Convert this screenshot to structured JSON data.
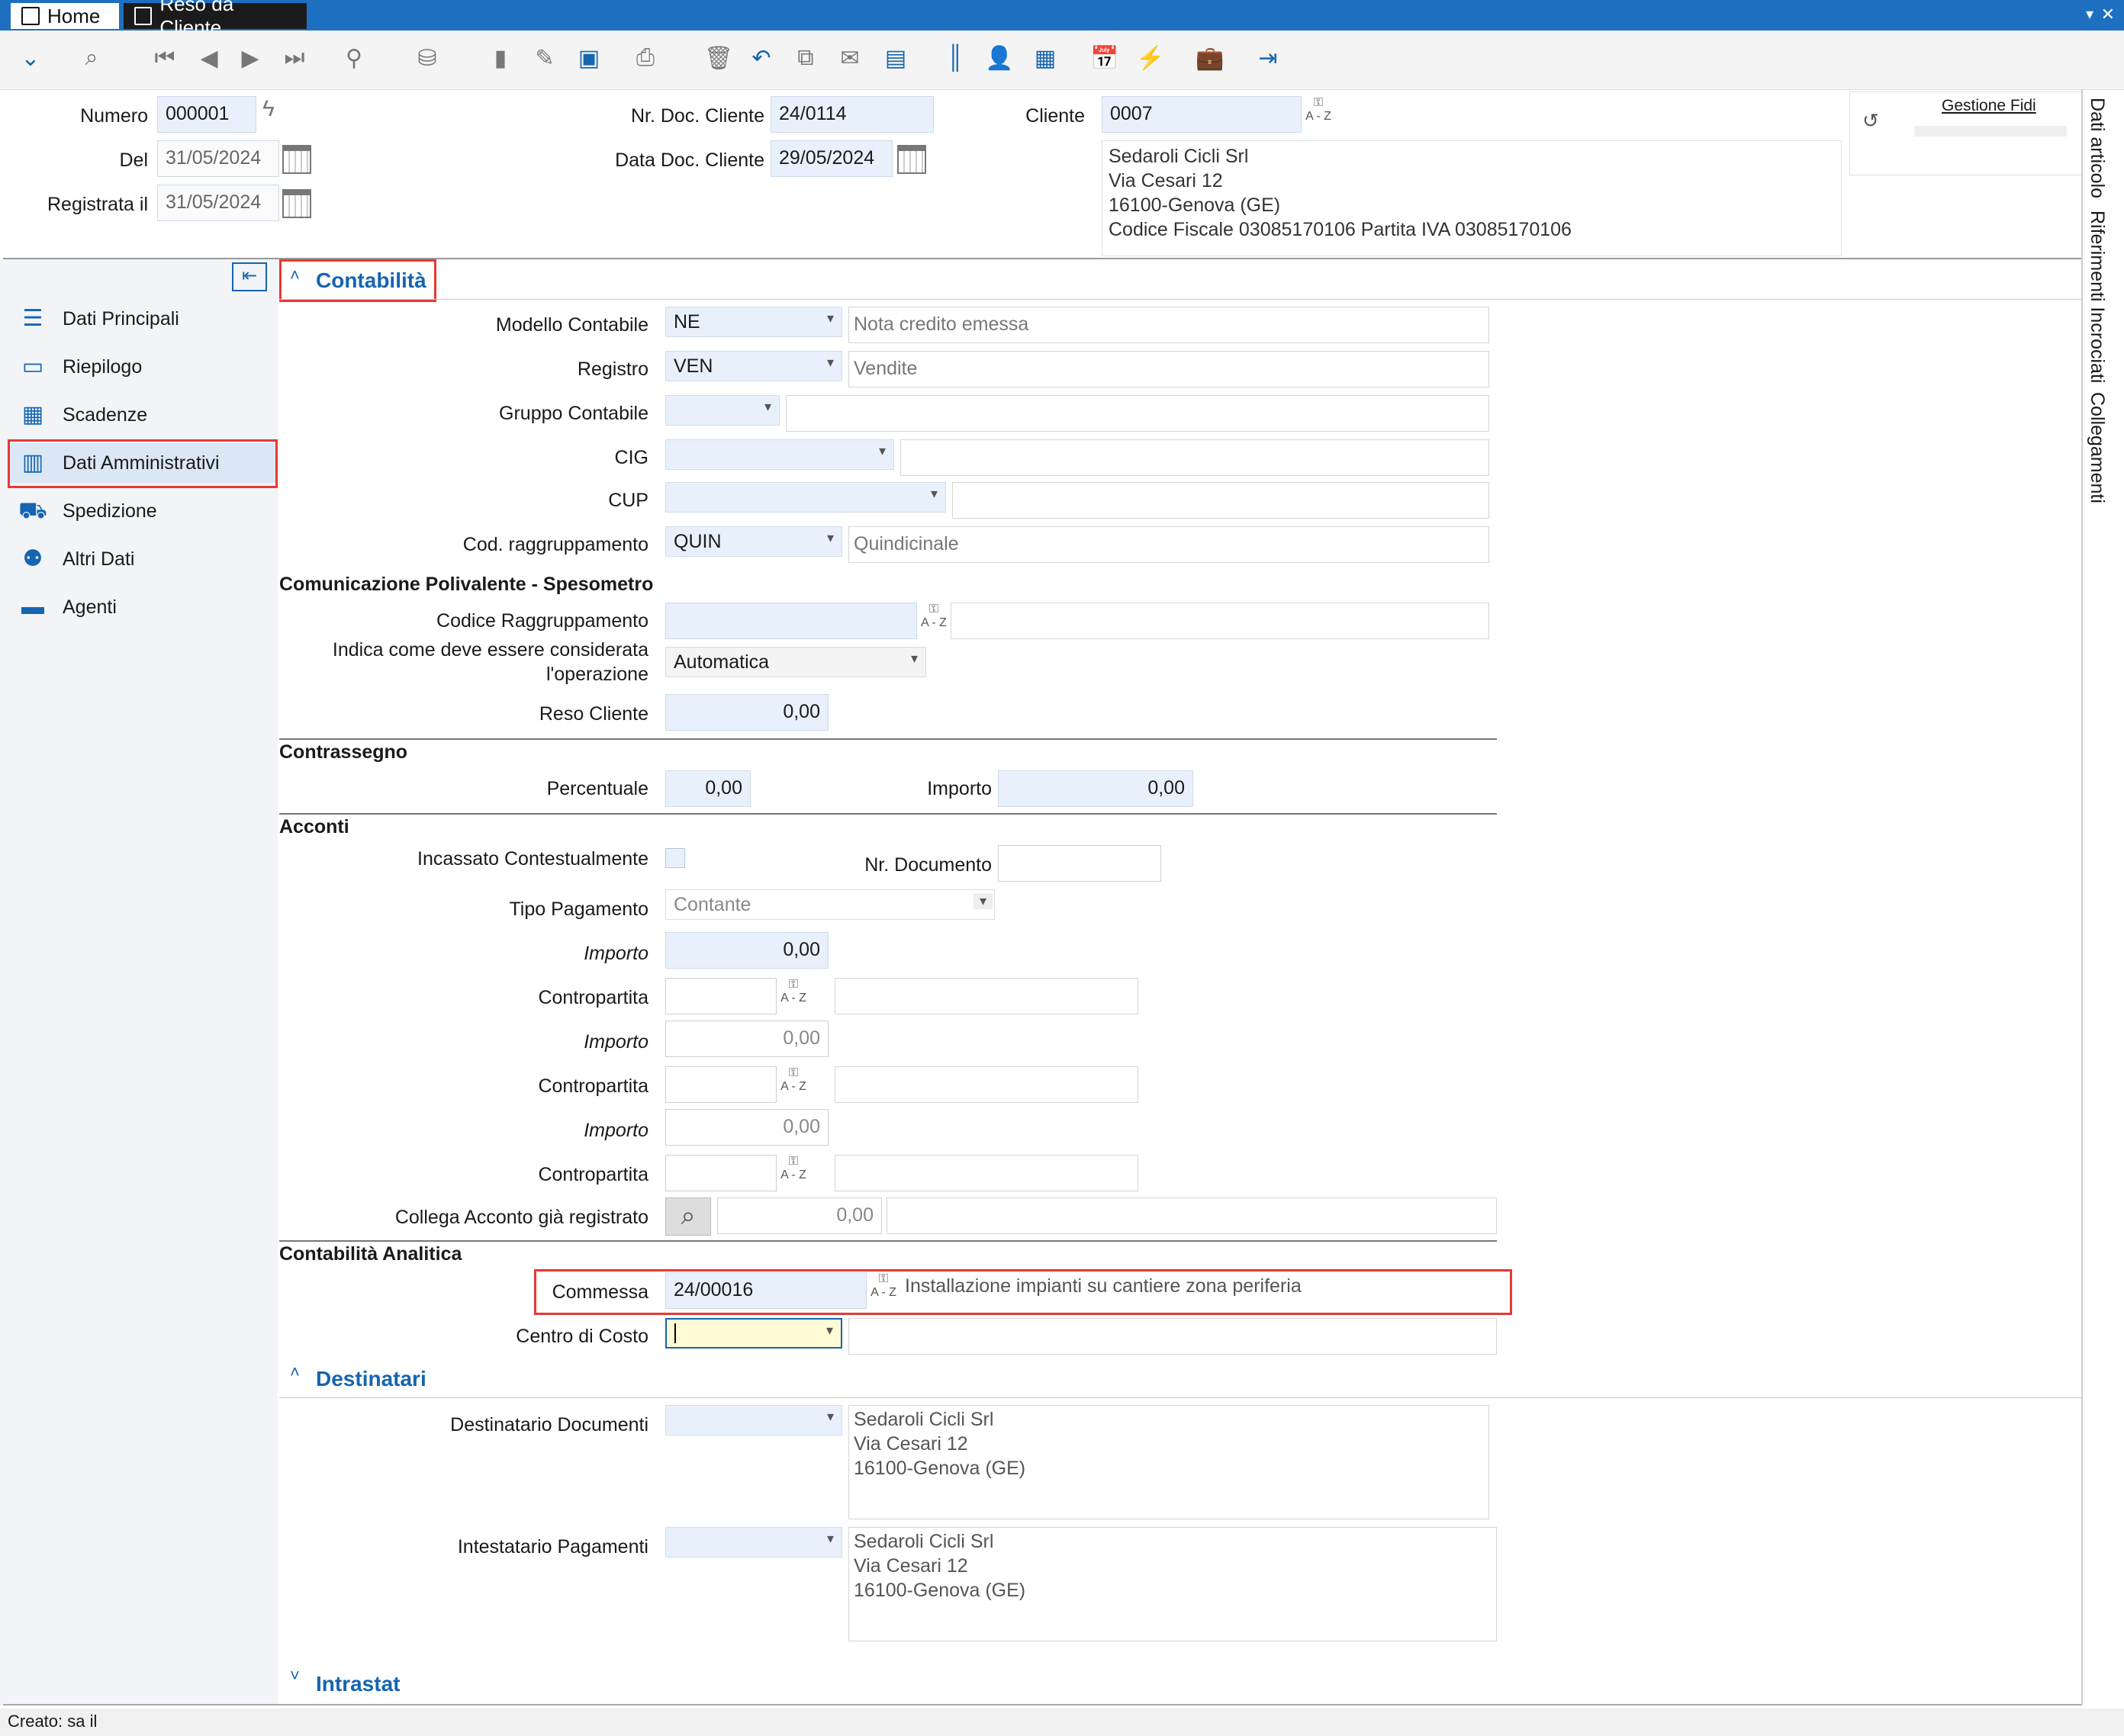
{
  "tabs": {
    "home": "Home",
    "reso": "Reso da Cliente"
  },
  "header": {
    "numero_label": "Numero",
    "numero": "000001",
    "del_label": "Del",
    "del": "31/05/2024",
    "registrata_label": "Registrata il",
    "registrata": "31/05/2024",
    "nrdoc_label": "Nr. Doc. Cliente",
    "nrdoc": "24/0114",
    "datadoc_label": "Data Doc. Cliente",
    "datadoc": "29/05/2024",
    "cliente_label": "Cliente",
    "cliente": "0007",
    "cliente_addr": [
      "Sedaroli Cicli Srl",
      "Via Cesari 12",
      "16100-Genova (GE)",
      "Codice Fiscale 03085170106 Partita IVA 03085170106"
    ],
    "gestione_fidi": "Gestione Fidi"
  },
  "key_label": "A - Z",
  "nav": [
    {
      "label": "Dati Principali",
      "icon": "stack-icon"
    },
    {
      "label": "Riepilogo",
      "icon": "money-icon"
    },
    {
      "label": "Scadenze",
      "icon": "calendar-icon"
    },
    {
      "label": "Dati Amministrativi",
      "icon": "books-icon"
    },
    {
      "label": "Spedizione",
      "icon": "truck-icon"
    },
    {
      "label": "Altri Dati",
      "icon": "add-person-icon"
    },
    {
      "label": "Agenti",
      "icon": "briefcase-icon"
    }
  ],
  "side_tabs": [
    "Dati articolo",
    "Riferimenti Incrociati",
    "Collegamenti"
  ],
  "contabilita": {
    "title": "Contabilità",
    "modello_label": "Modello Contabile",
    "modello": "NE",
    "modello_desc": "Nota credito emessa",
    "registro_label": "Registro",
    "registro": "VEN",
    "registro_desc": "Vendite",
    "gruppo_label": "Gruppo Contabile",
    "cig_label": "CIG",
    "cup_label": "CUP",
    "codragg_label": "Cod. raggruppamento",
    "codragg": "QUIN",
    "codragg_desc": "Quindicinale"
  },
  "spesometro": {
    "title": "Comunicazione Polivalente - Spesometro",
    "codice_label": "Codice Raggruppamento",
    "indica_label1": "Indica come deve essere considerata",
    "indica_label2": "l'operazione",
    "indica": "Automatica",
    "reso_label": "Reso Cliente",
    "reso": "0,00"
  },
  "contrassegno": {
    "title": "Contrassegno",
    "perc_label": "Percentuale",
    "perc": "0,00",
    "importo_label": "Importo",
    "importo": "0,00"
  },
  "acconti": {
    "title": "Acconti",
    "incassato_label": "Incassato Contestualmente",
    "nrdoc_label": "Nr. Documento",
    "tipo_label": "Tipo Pagamento",
    "tipo": "Contante",
    "importo_label": "Importo",
    "contropartita_label": "Contropartita",
    "importo1": "0,00",
    "importo2": "0,00",
    "importo3": "0,00",
    "collega_label": "Collega Acconto già registrato",
    "collega": "0,00"
  },
  "analitica": {
    "title": "Contabilità Analitica",
    "commessa_label": "Commessa",
    "commessa": "24/00016",
    "commessa_desc": "Installazione impianti su cantiere zona periferia",
    "centro_label": "Centro di Costo"
  },
  "destinatari": {
    "title": "Destinatari",
    "doc_label": "Destinatario Documenti",
    "doc_addr": [
      "Sedaroli Cicli Srl",
      "Via Cesari 12",
      "16100-Genova (GE)"
    ],
    "pag_label": "Intestatario Pagamenti",
    "pag_addr": [
      "Sedaroli Cicli Srl",
      "Via Cesari 12",
      "16100-Genova (GE)"
    ]
  },
  "intrastat": {
    "title": "Intrastat"
  },
  "status": "Creato: sa il"
}
